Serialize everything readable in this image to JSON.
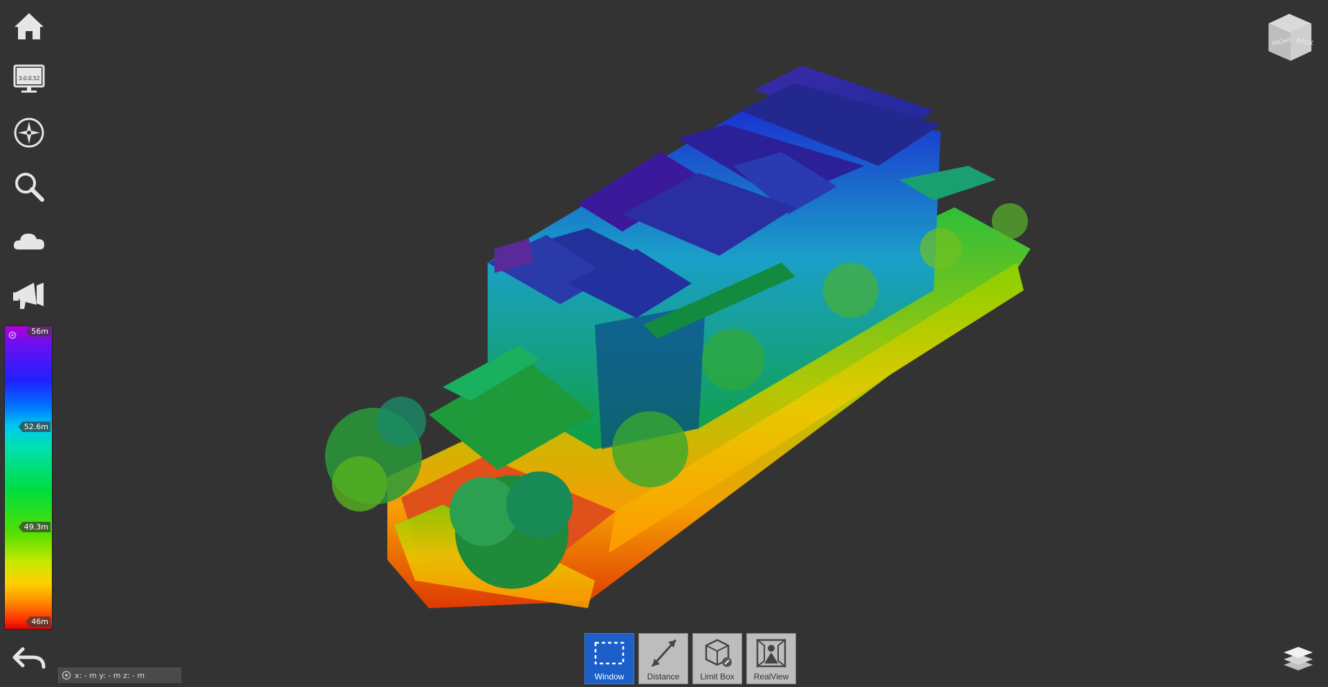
{
  "toolbar": {
    "items": [
      {
        "name": "home",
        "icon": "home-icon"
      },
      {
        "name": "monitor",
        "icon": "monitor-icon"
      },
      {
        "name": "navigation",
        "icon": "compass-icon"
      },
      {
        "name": "search",
        "icon": "search-icon"
      },
      {
        "name": "cloud",
        "icon": "cloud-icon"
      },
      {
        "name": "announce",
        "icon": "megaphone-icon"
      }
    ],
    "monitor_version": "3.0.0.52",
    "back_icon": "undo-arrow-icon"
  },
  "color_scale": {
    "max_label": "56m",
    "mid_upper_label": "52.6m",
    "mid_lower_label": "49.3m",
    "min_label": "46m",
    "settings_icon": "gear-icon"
  },
  "coordinates": {
    "icon": "target-icon",
    "text": "x: - m y: - m z: - m"
  },
  "tools": [
    {
      "label": "Window",
      "icon": "selection-window-icon",
      "active": true
    },
    {
      "label": "Distance",
      "icon": "measure-distance-icon",
      "active": false
    },
    {
      "label": "Limit Box",
      "icon": "limit-box-icon",
      "active": false
    },
    {
      "label": "RealView",
      "icon": "realview-icon",
      "active": false
    }
  ],
  "view_cube": {
    "face_labels": [
      "RIGHT",
      "BACK"
    ]
  },
  "colors": {
    "background": "#333333",
    "active_tool": "#1d5fc8",
    "tool_bg": "#bdbdbd"
  }
}
